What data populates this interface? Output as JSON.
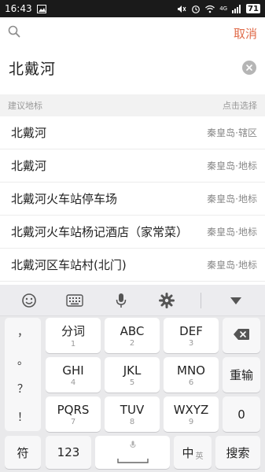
{
  "status_bar": {
    "time": "16:43",
    "battery": "71",
    "network": "4G"
  },
  "search": {
    "cancel_label": "取消",
    "query": "北戴河"
  },
  "suggestions": {
    "header_left": "建议地标",
    "header_right": "点击选择",
    "items": [
      {
        "name": "北戴河",
        "region": "秦皇岛·辖区"
      },
      {
        "name": "北戴河",
        "region": "秦皇岛·地标"
      },
      {
        "name": "北戴河火车站停车场",
        "region": "秦皇岛·地标"
      },
      {
        "name": "北戴河火车站杨记酒店（家常菜）",
        "region": "秦皇岛·地标"
      },
      {
        "name": "北戴河区车站村(北门)",
        "region": "秦皇岛·地标"
      }
    ]
  },
  "keyboard": {
    "toolbar": [
      "emoji-icon",
      "keyboard-icon",
      "microphone-icon",
      "settings-icon",
      "collapse-icon"
    ],
    "punctuation": [
      "，",
      "。",
      "？",
      "！"
    ],
    "keys": {
      "k1": {
        "main": "分词",
        "sub": "1"
      },
      "k2": {
        "main": "ABC",
        "sub": "2"
      },
      "k3": {
        "main": "DEF",
        "sub": "3"
      },
      "k4": {
        "main": "GHI",
        "sub": "4"
      },
      "k5": {
        "main": "JKL",
        "sub": "5"
      },
      "k6": {
        "main": "MNO",
        "sub": "6"
      },
      "k7": {
        "main": "PQRS",
        "sub": "7"
      },
      "k8": {
        "main": "TUV",
        "sub": "8"
      },
      "k9": {
        "main": "WXYZ",
        "sub": "9"
      }
    },
    "reenter_label": "重输",
    "zero_label": "0",
    "symbols_label": "符",
    "numbers_label": "123",
    "lang_label": "中",
    "lang_sub": "英",
    "search_label": "搜索"
  }
}
